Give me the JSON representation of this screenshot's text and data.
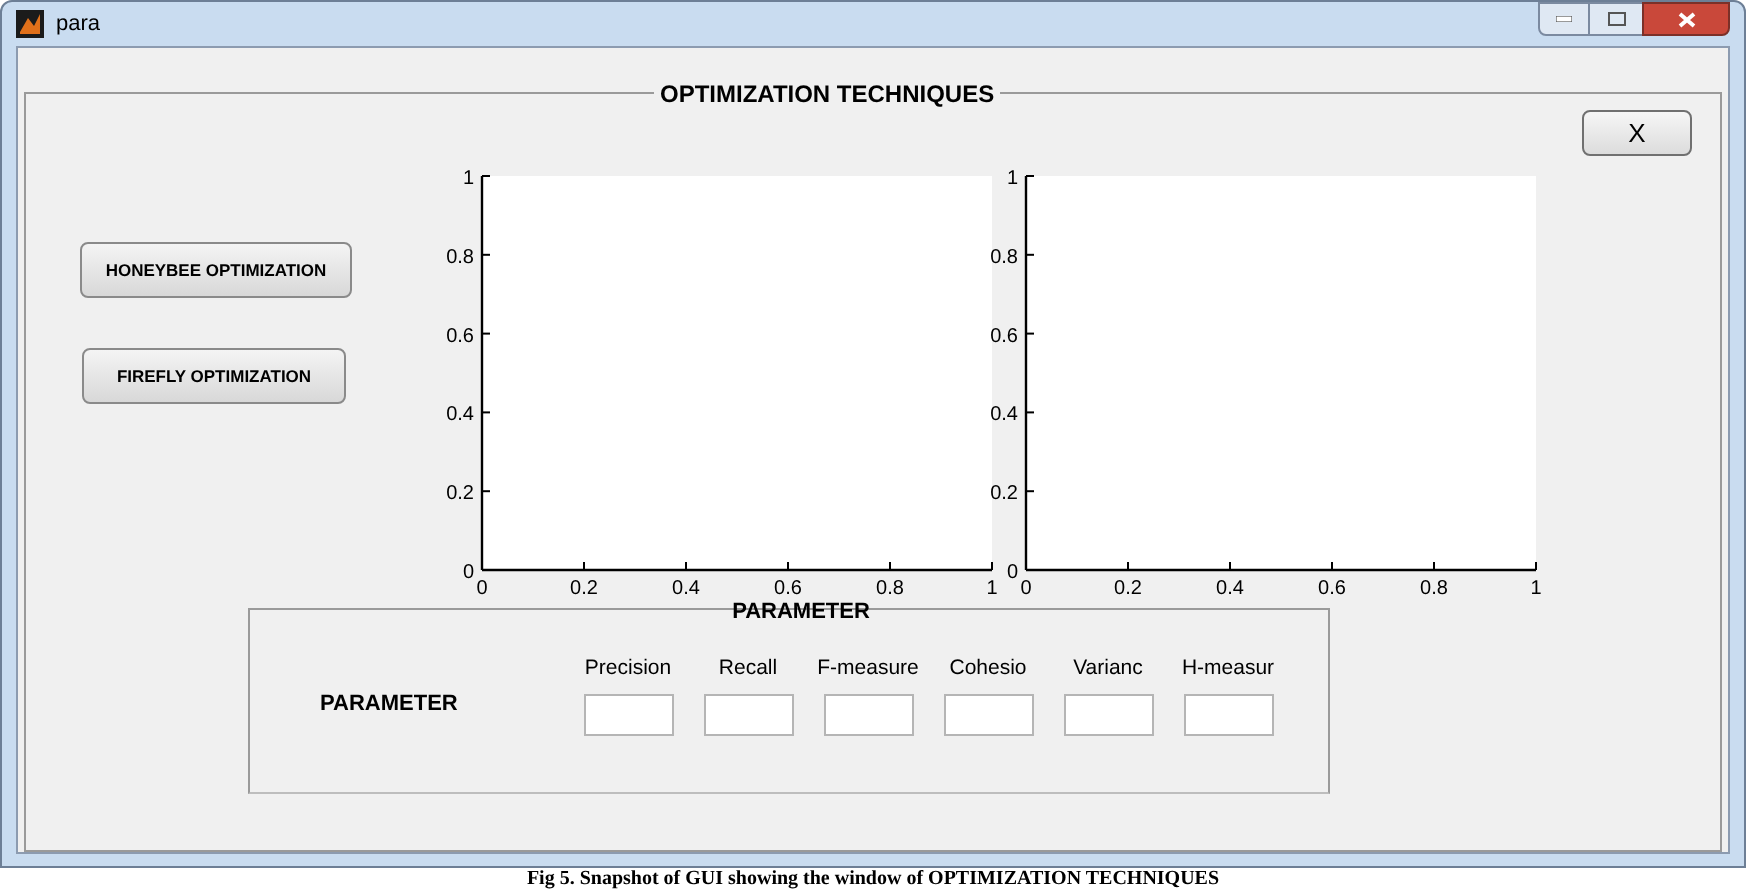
{
  "window": {
    "title": "para"
  },
  "panel": {
    "title": "OPTIMIZATION TECHNIQUES"
  },
  "close_button": "X",
  "buttons": [
    {
      "label": "HONEYBEE OPTIMIZATION"
    },
    {
      "label": "FIREFLY OPTIMIZATION"
    }
  ],
  "charts": [
    {
      "chart_data": {
        "type": "line",
        "xlabel": "PARAMETER",
        "xlim": [
          0,
          1
        ],
        "ylim": [
          0,
          1
        ],
        "xticks": [
          {
            "value": 0,
            "label": "0"
          },
          {
            "value": 0.2,
            "label": "0.2"
          },
          {
            "value": 0.4,
            "label": "0.4"
          },
          {
            "value": 0.6,
            "label": "0.6"
          },
          {
            "value": 0.8,
            "label": "0.8"
          },
          {
            "value": 1,
            "label": "1"
          }
        ],
        "yticks": [
          {
            "value": 0,
            "label": "0"
          },
          {
            "value": 0.2,
            "label": "0.2"
          },
          {
            "value": 0.4,
            "label": "0.4"
          },
          {
            "value": 0.6,
            "label": "0.6"
          },
          {
            "value": 0.8,
            "label": "0.8"
          },
          {
            "value": 1,
            "label": "1"
          }
        ]
      }
    },
    {
      "chart_data": {
        "type": "line",
        "xlim": [
          0,
          1
        ],
        "ylim": [
          0,
          1
        ],
        "xticks": [
          {
            "value": 0,
            "label": "0"
          },
          {
            "value": 0.2,
            "label": "0.2"
          },
          {
            "value": 0.4,
            "label": "0.4"
          },
          {
            "value": 0.6,
            "label": "0.6"
          },
          {
            "value": 0.8,
            "label": "0.8"
          },
          {
            "value": 1,
            "label": "1"
          }
        ],
        "yticks": [
          {
            "value": 0,
            "label": "0"
          },
          {
            "value": 0.2,
            "label": "0.2"
          },
          {
            "value": 0.4,
            "label": "0.4"
          },
          {
            "value": 0.6,
            "label": "0.6"
          },
          {
            "value": 0.8,
            "label": "0.8"
          },
          {
            "value": 1,
            "label": "1"
          }
        ]
      }
    }
  ],
  "parameter_panel": {
    "label": "PARAMETER",
    "fields": [
      {
        "label": "Precision"
      },
      {
        "label": "Recall"
      },
      {
        "label": "F-measure"
      },
      {
        "label": "Cohesio"
      },
      {
        "label": "Varianc"
      },
      {
        "label": "H-measur"
      }
    ]
  },
  "caption": "Fig 5. Snapshot of GUI showing the window of OPTIMIZATION TECHNIQUES"
}
